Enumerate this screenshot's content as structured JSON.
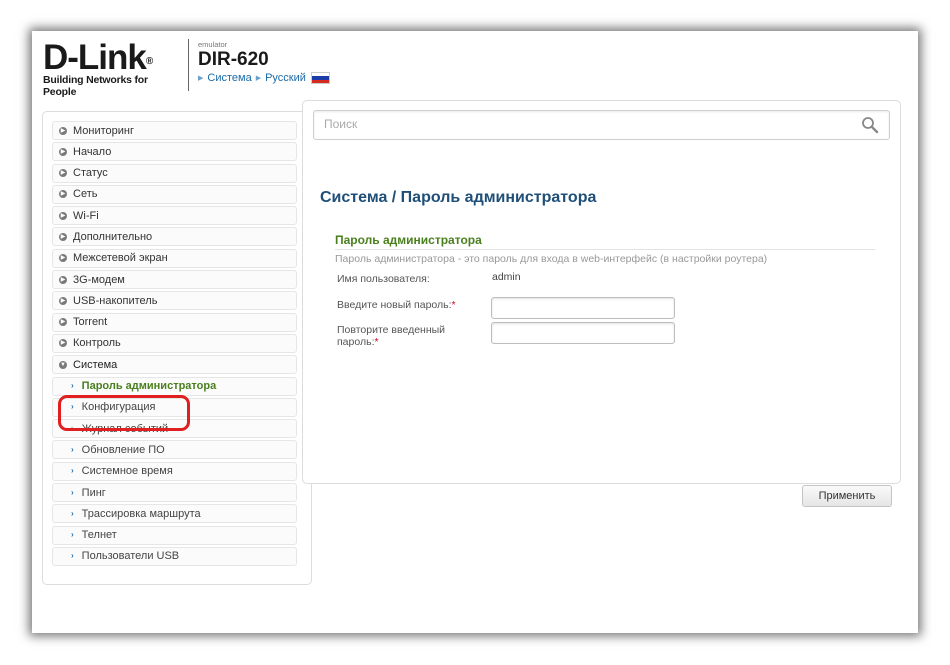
{
  "header": {
    "logo_text": "D-Link",
    "logo_reg": "®",
    "tagline": "Building Networks for People",
    "emulator": "emulator",
    "model": "DIR-620",
    "crumb_system": "Система",
    "crumb_language": "Русский"
  },
  "sidebar": {
    "items": [
      {
        "label": "Мониторинг"
      },
      {
        "label": "Начало"
      },
      {
        "label": "Статус"
      },
      {
        "label": "Сеть"
      },
      {
        "label": "Wi-Fi"
      },
      {
        "label": "Дополнительно"
      },
      {
        "label": "Межсетевой экран"
      },
      {
        "label": "3G-модем"
      },
      {
        "label": "USB-накопитель"
      },
      {
        "label": "Torrent"
      },
      {
        "label": "Контроль"
      },
      {
        "label": "Система"
      }
    ],
    "subitems": [
      {
        "label": "Пароль администратора"
      },
      {
        "label": "Конфигурация"
      },
      {
        "label": "Журнал событий"
      },
      {
        "label": "Обновление ПО"
      },
      {
        "label": "Системное время"
      },
      {
        "label": "Пинг"
      },
      {
        "label": "Трассировка маршрута"
      },
      {
        "label": "Телнет"
      },
      {
        "label": "Пользователи USB"
      }
    ]
  },
  "search": {
    "placeholder": "Поиск"
  },
  "main": {
    "page_title": "Система /  Пароль администратора",
    "section_title": "Пароль администратора",
    "section_desc": "Пароль администратора - это пароль для входа в web-интерфейс (в настройки роутера)",
    "username_label": "Имя пользователя:",
    "username_value": "admin",
    "new_password_label": "Введите новый пароль:",
    "repeat_password_label_1": "Повторите введенный",
    "repeat_password_label_2": "пароль:",
    "required_mark": "*",
    "apply_label": "Применить"
  },
  "colors": {
    "link": "#1a6aa8",
    "section_green": "#4a7f1e",
    "title_blue": "#1f4f78",
    "highlight_red": "#e02020"
  }
}
